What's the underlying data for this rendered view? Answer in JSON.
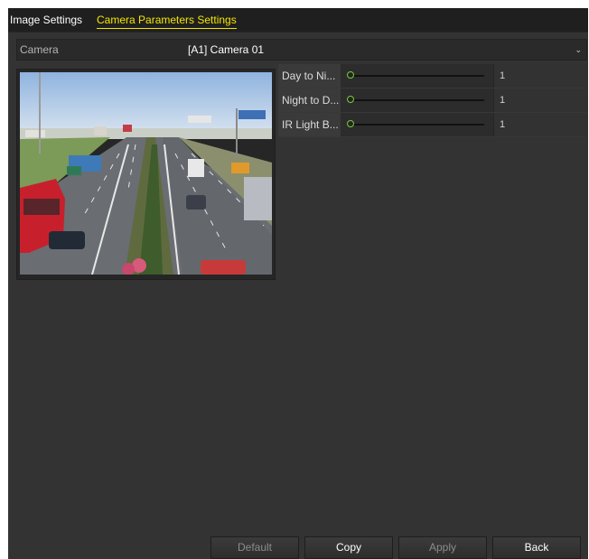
{
  "tabs": {
    "image_settings": "Image Settings",
    "camera_parameters": "Camera Parameters Settings"
  },
  "camera": {
    "label": "Camera",
    "selected": "[A1] Camera 01"
  },
  "params": [
    {
      "label": "Day to Ni...",
      "value": "1",
      "level": 0
    },
    {
      "label": "Night to D...",
      "value": "1",
      "level": 0
    },
    {
      "label": "IR Light B...",
      "value": "1",
      "level": 0
    }
  ],
  "buttons": {
    "default": "Default",
    "copy": "Copy",
    "apply": "Apply",
    "back": "Back"
  },
  "colors": {
    "active_tab": "#f3e600",
    "panel_bg": "#333333",
    "slider_accent": "#7fc44b"
  },
  "icons": {
    "camera_dropdown": "chevron-down-icon"
  }
}
